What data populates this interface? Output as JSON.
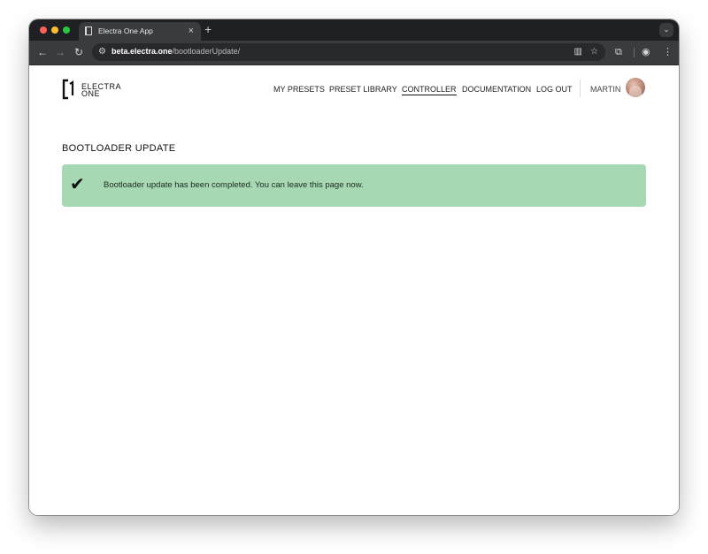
{
  "browser": {
    "tab": {
      "title": "Electra One App",
      "close": "×"
    },
    "new_tab": "+",
    "tab_search": "⌄",
    "address": {
      "host": "beta.electra.one",
      "path": "/bootloaderUpdate/"
    },
    "icons": {
      "back": "←",
      "forward": "→",
      "reload": "↻",
      "site_info": "⚙",
      "reader": "▥",
      "star": "☆",
      "extensions": "⧉",
      "profile": "◉",
      "menu": "⋮"
    }
  },
  "app": {
    "logo": {
      "line1": "ELECTRA",
      "line2": "ONE"
    },
    "nav": [
      {
        "label": "MY PRESETS",
        "active": false
      },
      {
        "label": "PRESET LIBRARY",
        "active": false
      },
      {
        "label": "CONTROLLER",
        "active": true
      },
      {
        "label": "DOCUMENTATION",
        "active": false
      },
      {
        "label": "LOG OUT",
        "active": false
      }
    ],
    "user": "MARTIN",
    "page_title": "BOOTLOADER UPDATE",
    "alert": {
      "icon": "✔",
      "message": "Bootloader update has been completed. You can leave this page now.",
      "color": "#a6d8b3"
    }
  }
}
